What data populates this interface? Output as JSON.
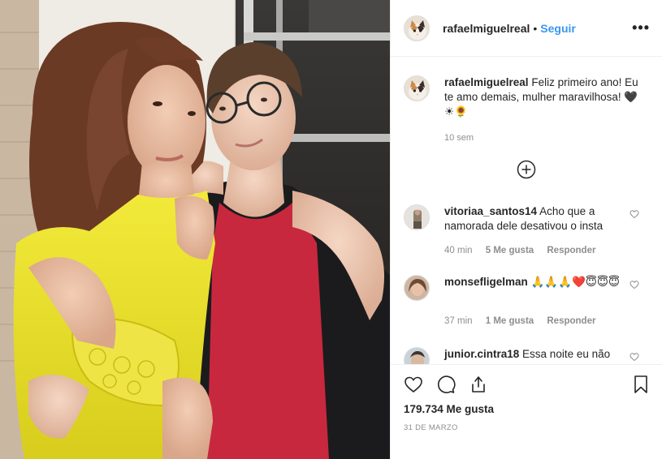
{
  "post": {
    "author": "rafaelmiguelreal",
    "separator": "•",
    "follow_label": "Seguir",
    "more_icon": "more-options-icon",
    "more_label": "•••"
  },
  "caption": {
    "username": "rafaelmiguelreal",
    "text": "Feliz primeiro ano! Eu te amo demais, mulher maravilhosa! 🖤☀🌻",
    "time": "10 sem"
  },
  "load_more_icon": "plus-circle-icon",
  "comments": [
    {
      "username": "vitoriaa_santos14",
      "text": "Acho que a namorada dele desativou o insta",
      "time": "40 min",
      "likes": "5 Me gusta",
      "reply": "Responder"
    },
    {
      "username": "monsefligelman",
      "text": "🙏🙏🙏❤️😇😇😇",
      "time": "37 min",
      "likes": "1 Me gusta",
      "reply": "Responder"
    },
    {
      "username": "junior.cintra18",
      "text": "Essa noite eu não"
    }
  ],
  "actions": {
    "like_icon": "heart-icon",
    "comment_icon": "comment-icon",
    "share_icon": "share-icon",
    "save_icon": "bookmark-icon",
    "likes_count": "179.734 Me gusta",
    "date": "31 DE MARZO"
  },
  "colors": {
    "link_blue": "#3897f0",
    "text": "#262626",
    "muted": "#8e8e8e",
    "border": "#efefef"
  }
}
